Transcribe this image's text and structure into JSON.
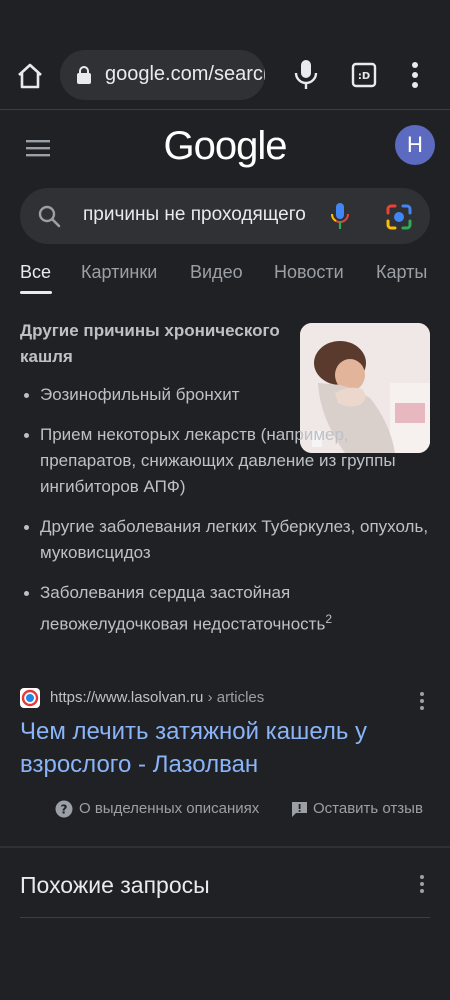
{
  "browser": {
    "url": "google.com/search",
    "home_icon": "home-icon",
    "lock_icon": "lock-icon",
    "mic_icon": "microphone-icon",
    "tab_icon": "tab-switcher-icon",
    "menu_icon": "more-vert-icon"
  },
  "header": {
    "logo": "Google",
    "avatar_letter": "H",
    "avatar_color": "#5c6bc0"
  },
  "search": {
    "query": "причины не проходящего кашля"
  },
  "tabs": [
    {
      "label": "Все",
      "active": true
    },
    {
      "label": "Картинки"
    },
    {
      "label": "Видео"
    },
    {
      "label": "Новости"
    },
    {
      "label": "Карты"
    }
  ],
  "snippet": {
    "title": "Другие причины хронического кашля",
    "bullets": [
      "Эозинофильный бронхит",
      "Прием некоторых лекарств (например, препаратов, снижающих давление из группы ингибиторов АПФ)",
      "Другие заболевания легких Туберкулез, опухоль, муковисцидоз",
      "Заболевания сердца застойная левожелудочковая недостаточность"
    ],
    "footnote": "2"
  },
  "result": {
    "url": "https://www.lasolvan.ru",
    "breadcrumb": " › articles",
    "title": "Чем лечить затяжной кашель у взрослого - Лазолван"
  },
  "feedback": {
    "about_label": "О выделенных описаниях",
    "feedback_label": "Оставить отзыв"
  },
  "related": {
    "title": "Похожие запросы"
  },
  "colors": {
    "background": "#202124",
    "link": "#8ab4f8",
    "text": "#e8eaed",
    "muted": "#9aa0a6"
  }
}
